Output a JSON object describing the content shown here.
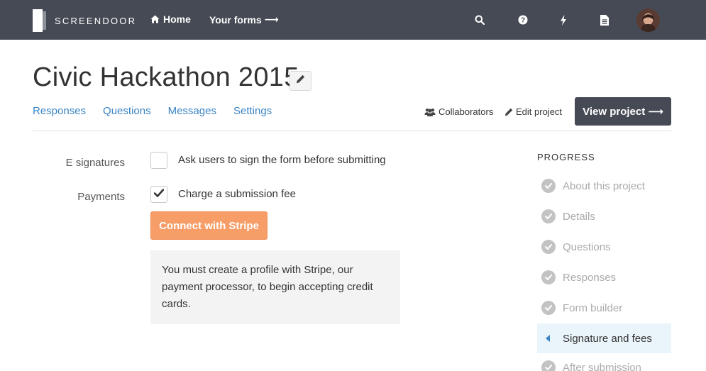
{
  "brand": {
    "name": "SCREENDOOR"
  },
  "nav": {
    "home_label": "Home",
    "forms_label": "Your forms",
    "forms_arrow": "⟶"
  },
  "icons": {
    "search": "search-icon",
    "help": "question-circle-icon",
    "bolt": "lightning-bolt-icon",
    "docs": "document-icon"
  },
  "project": {
    "title": "Civic Hackathon 2015"
  },
  "tabs": [
    {
      "label": "Responses"
    },
    {
      "label": "Questions"
    },
    {
      "label": "Messages"
    },
    {
      "label": "Settings"
    }
  ],
  "actions": {
    "collaborators_label": "Collaborators",
    "edit_project_label": "Edit project",
    "view_project_label": "View project ⟶"
  },
  "form": {
    "esignatures": {
      "label": "E signatures",
      "option": "Ask users to sign the form before submitting",
      "checked": false
    },
    "payments": {
      "label": "Payments",
      "option": "Charge a submission fee",
      "checked": true
    },
    "stripe_button": "Connect with Stripe",
    "stripe_note": "You must create a profile with Stripe, our payment processor, to begin accepting credit cards."
  },
  "progress": {
    "title": "PROGRESS",
    "steps": [
      {
        "label": "About this project",
        "state": "done"
      },
      {
        "label": "Details",
        "state": "done"
      },
      {
        "label": "Questions",
        "state": "done"
      },
      {
        "label": "Responses",
        "state": "done"
      },
      {
        "label": "Form builder",
        "state": "done"
      },
      {
        "label": "Signature and fees",
        "state": "active"
      },
      {
        "label": "After submission",
        "state": "done"
      }
    ]
  },
  "colors": {
    "topbar": "#454a54",
    "link": "#3a84c4",
    "stripe": "#f79d68",
    "active_step_bg": "#eaf4fb"
  }
}
